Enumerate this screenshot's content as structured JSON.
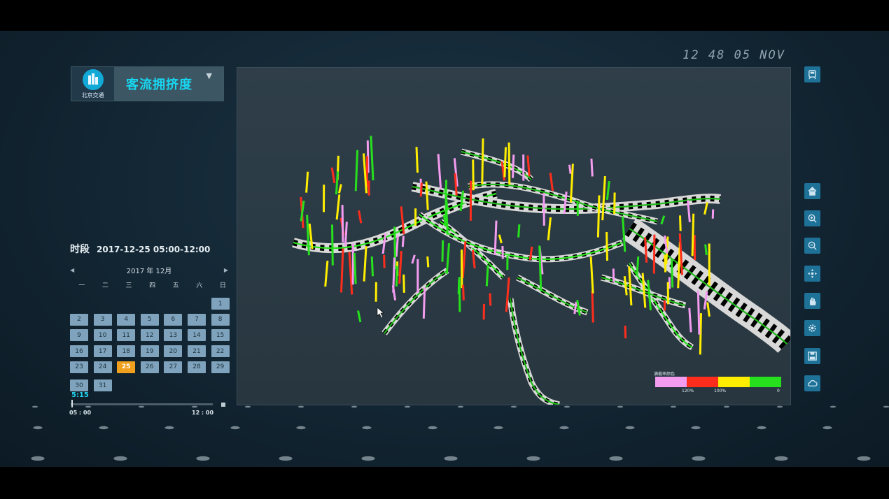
{
  "clock": "12 48 05 NOV",
  "header": {
    "logo_text": "北京交通",
    "title": "客流拥挤度",
    "dropdown_icon": "triangle-down-icon"
  },
  "period": {
    "label": "时段",
    "value": "2017-12-25 05:00-12:00"
  },
  "calendar": {
    "month_label": "2017 年 12月",
    "prev_icon": "chevron-left-icon",
    "next_icon": "chevron-right-icon",
    "weekdays": [
      "一",
      "二",
      "三",
      "四",
      "五",
      "六",
      "日"
    ],
    "days": [
      "1",
      "2",
      "3",
      "4",
      "5",
      "6",
      "7",
      "8",
      "9",
      "10",
      "11",
      "12",
      "13",
      "14",
      "15",
      "16",
      "17",
      "18",
      "19",
      "20",
      "21",
      "22",
      "23",
      "24",
      "25",
      "26",
      "27",
      "28",
      "29",
      "30",
      "31"
    ],
    "selected_day": "25",
    "first_weekday_index": 6
  },
  "timeline": {
    "current": "5:15",
    "start": "05 : 00",
    "end": "12 : 00",
    "progress": 0.0
  },
  "legend": {
    "title": "满载率颜色",
    "colors": [
      "#f39cf0",
      "#ff2e1c",
      "#ffee00",
      "#27e01d"
    ],
    "ticks": [
      "120%",
      "100%",
      "0"
    ]
  },
  "toolbar": {
    "top_icon": "train-icon",
    "icons": [
      "home-icon",
      "zoom-in-icon",
      "zoom-out-icon",
      "move-icon",
      "hand-icon",
      "settings-icon",
      "save-icon",
      "cloud-icon"
    ]
  },
  "accent_color": "#18d6f0"
}
